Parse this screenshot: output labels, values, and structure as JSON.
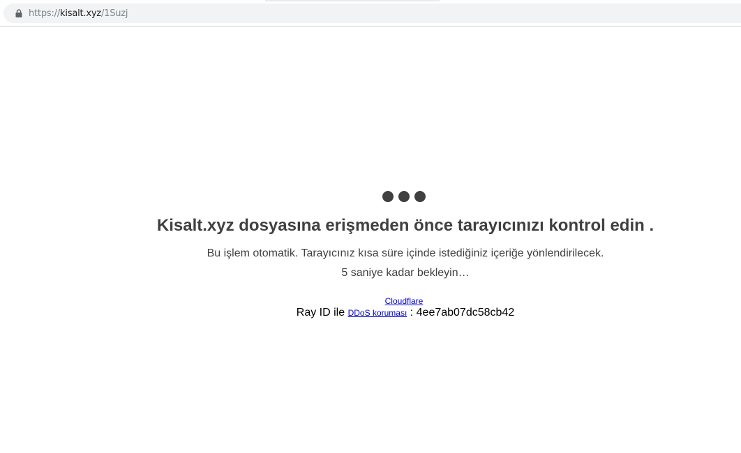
{
  "browser": {
    "url_scheme": "https://",
    "url_host": "kisalt.xyz",
    "url_path": "/1Suzj"
  },
  "page": {
    "heading": "Kisalt.xyz dosyasına erişmeden önce tarayıcınızı kontrol edin .",
    "line1": "Bu işlem otomatik. Tarayıcınız kısa süre içinde istediğiniz içeriğe yönlendirilecek.",
    "line2": "5 saniye kadar bekleyin…",
    "cloudflare_link": "Cloudflare",
    "ray_prefix": "Ray ID ile",
    "ddos_link": "DDoS koruması",
    "ray_suffix": ": 4ee7ab07dc58cb42"
  },
  "colors": {
    "text": "#404040",
    "link": "#0000cc",
    "dots": "#404040"
  }
}
